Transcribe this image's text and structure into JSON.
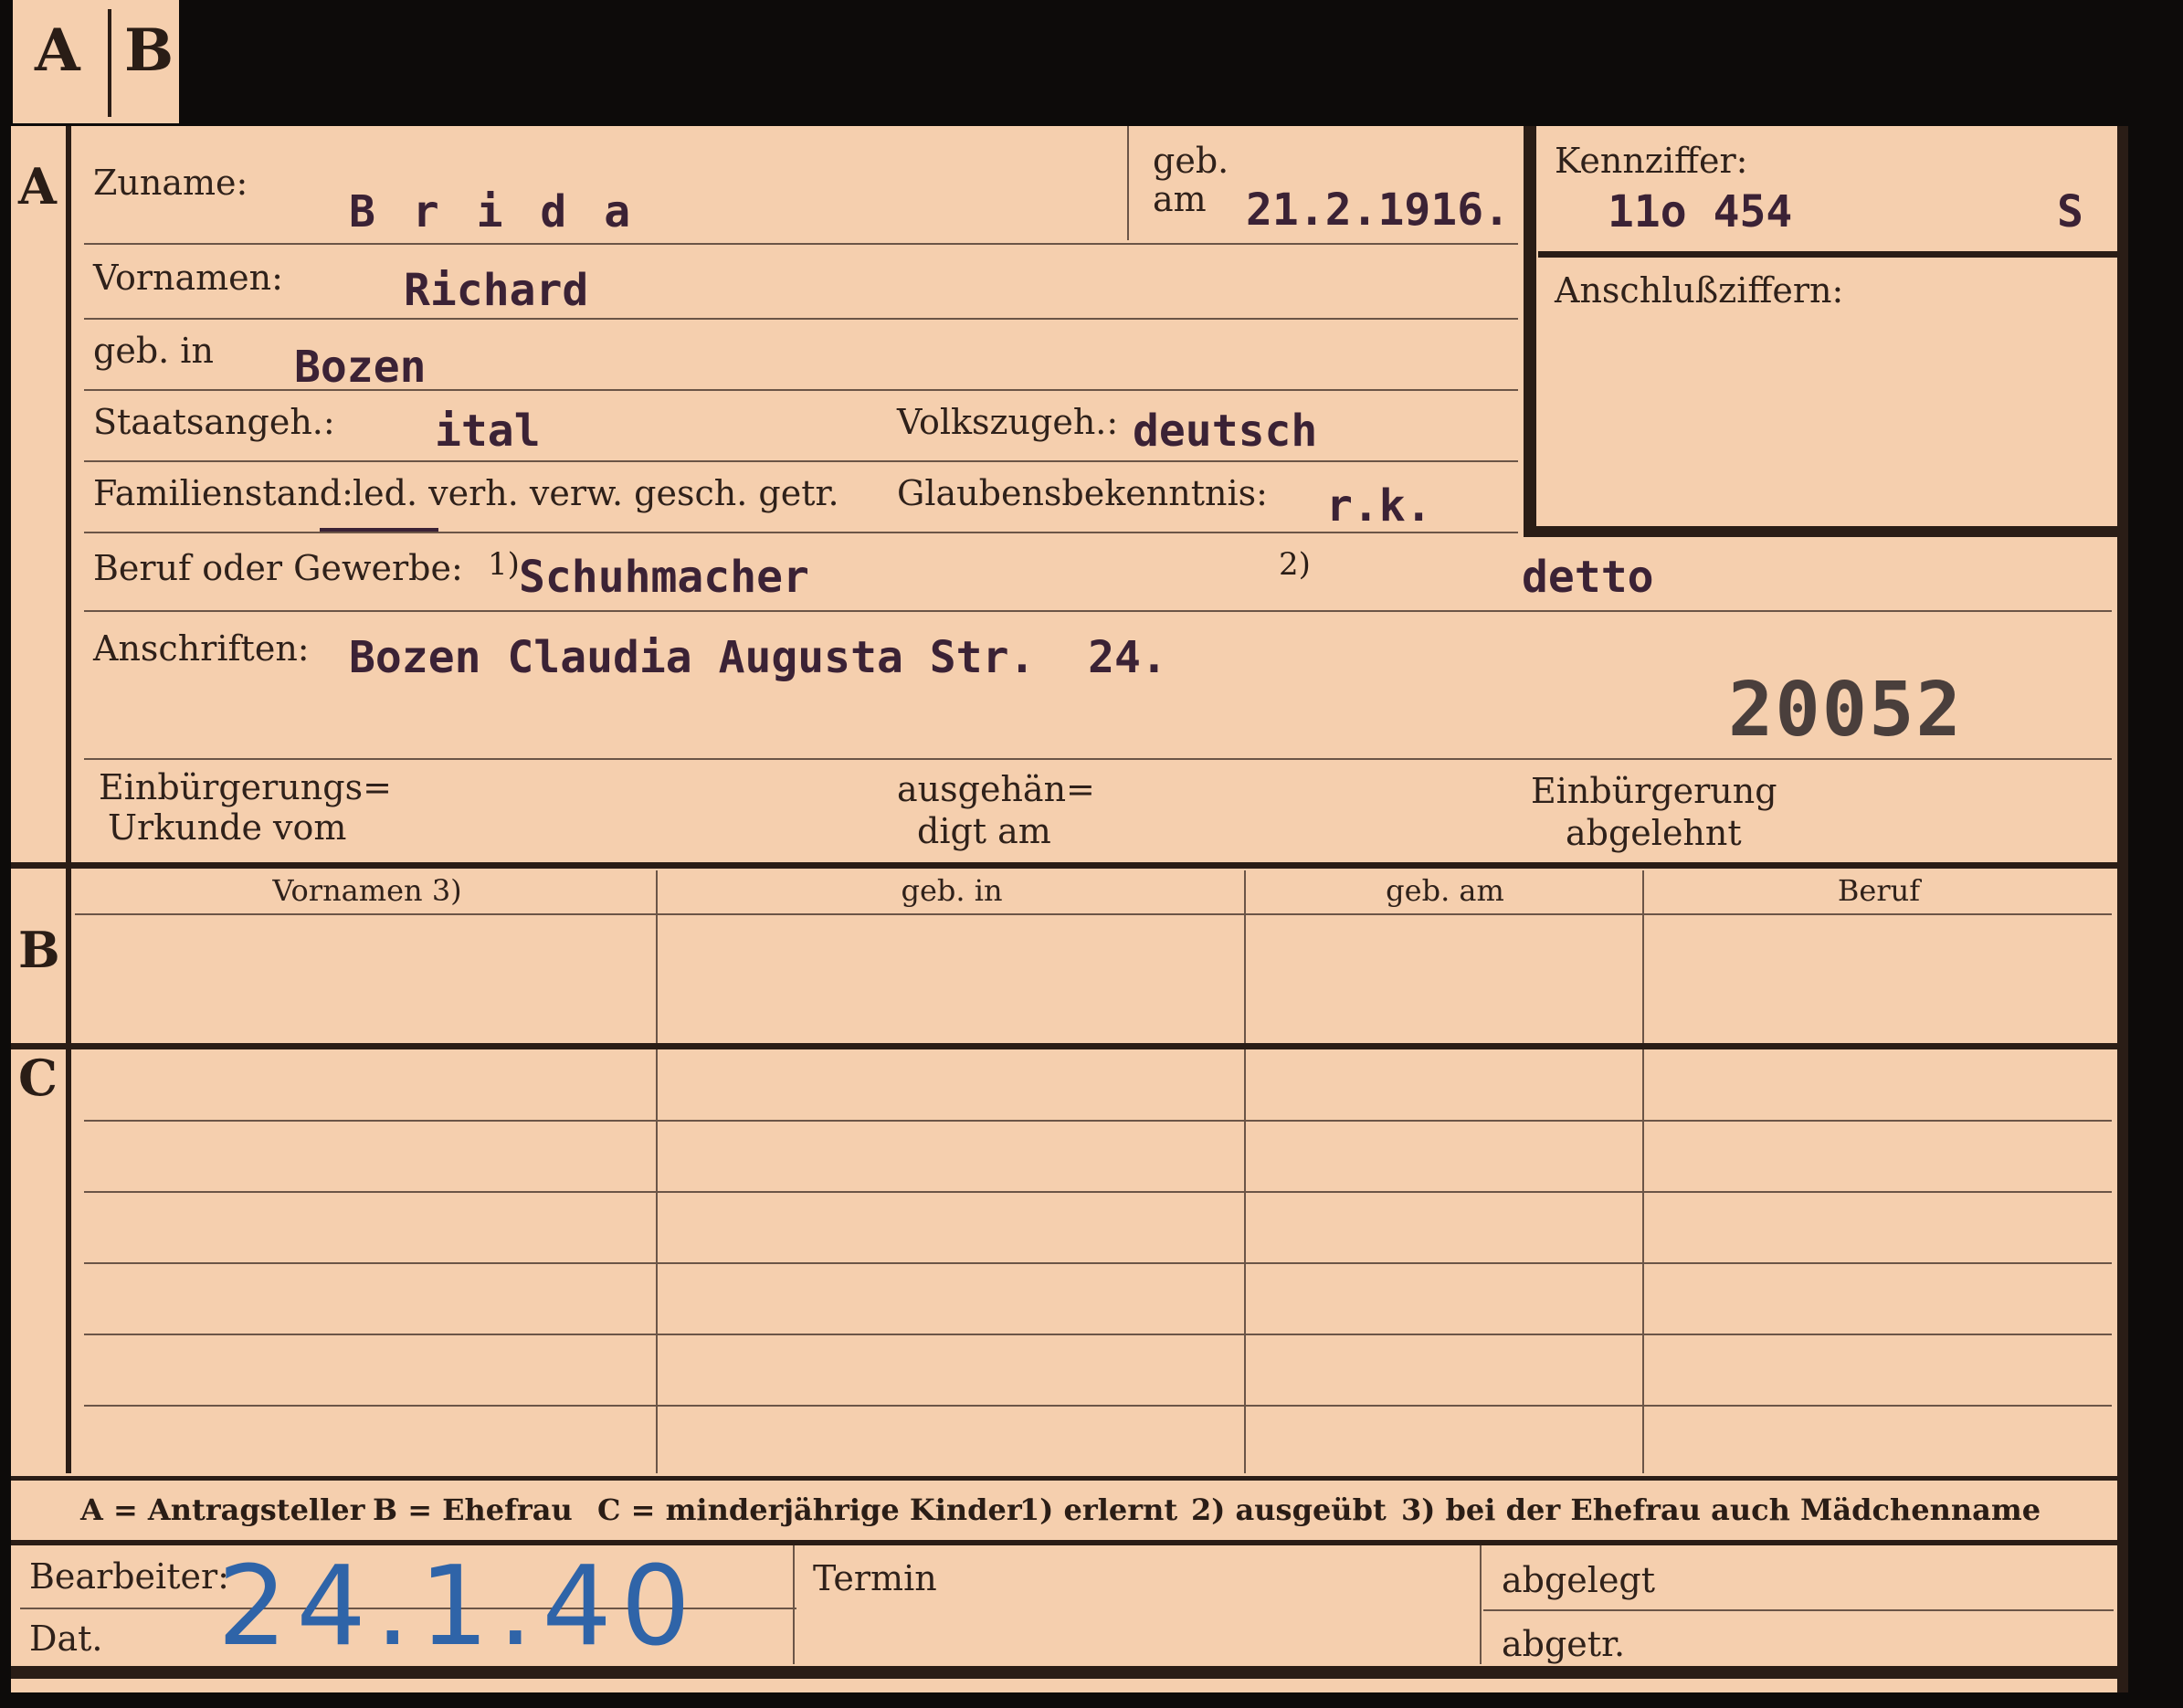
{
  "tab": {
    "a": "A",
    "b": "B"
  },
  "sections": {
    "a": "A",
    "b": "B",
    "c": "C"
  },
  "applicant": {
    "surname_label": "Zuname:",
    "surname": "B r i d a",
    "birth_date_label_1": "geb.",
    "birth_date_label_2": "am",
    "birth_date": "21.2.1916.",
    "id_label": "Kennziffer:",
    "id_number": "11o 454",
    "id_suffix": "S",
    "linked_label": "Anschlußziffern:",
    "first_names_label": "Vornamen:",
    "first_names": "Richard",
    "birthplace_label": "geb. in",
    "birthplace": "Bozen",
    "citizenship_label": "Staatsangeh.:",
    "citizenship": "ital",
    "ethnicity_label": "Volkszugeh.:",
    "ethnicity": "deutsch",
    "marital_label": "Familienstand:",
    "marital_options": "led. verh. verw. gesch. getr.",
    "religion_label": "Glaubensbekenntnis:",
    "religion": "r.k.",
    "occupation_label": "Beruf oder Gewerbe:",
    "occupation_fn1": "1)",
    "occupation_learned": "Schuhmacher",
    "occupation_fn2": "2)",
    "occupation_practiced": "detto",
    "address_label": "Anschriften:",
    "address": "Bozen Claudia Augusta Str.  24.",
    "stamp_number": "20052",
    "naturalization_cert_label_1": "Einbürgerungs=",
    "naturalization_cert_label_2": "Urkunde vom",
    "handed_out_label_1": "ausgehän=",
    "handed_out_label_2": "digt am",
    "naturalization_rejected_label_1": "Einbürgerung",
    "naturalization_rejected_label_2": "abgelehnt"
  },
  "table_headers": [
    "Vornamen 3)",
    "geb. in",
    "geb. am",
    "Beruf"
  ],
  "legend": {
    "a": "A = Antragsteller",
    "b": "B = Ehefrau",
    "c": "C = minderjährige Kinder",
    "fn1": "1) erlernt",
    "fn2": "2) ausgeübt",
    "fn3": "3) bei der Ehefrau auch Mädchenname"
  },
  "footer": {
    "processor_label": "Bearbeiter:",
    "date_label": "Dat.",
    "handwritten_date": "24.1.40",
    "deadline_label": "Termin",
    "filed_label": "abgelegt",
    "removed_label": "abgetr."
  }
}
